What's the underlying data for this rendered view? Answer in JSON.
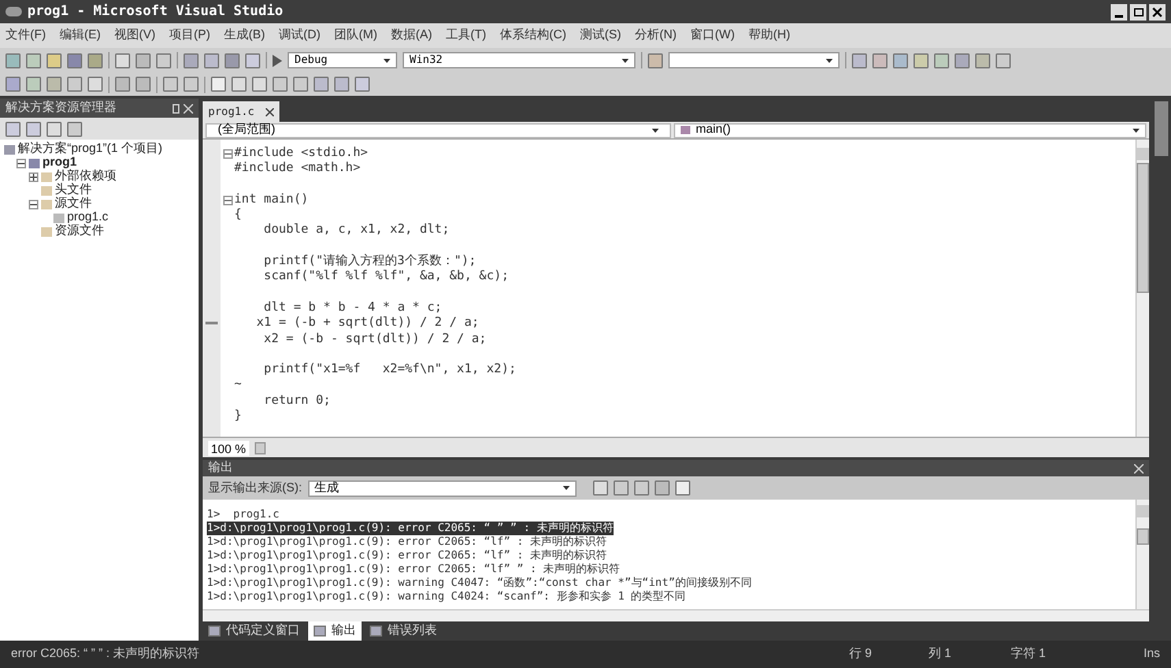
{
  "window": {
    "title": "prog1 - Microsoft Visual Studio"
  },
  "menu": [
    "文件(F)",
    "编辑(E)",
    "视图(V)",
    "项目(P)",
    "生成(B)",
    "调试(D)",
    "团队(M)",
    "数据(A)",
    "工具(T)",
    "体系结构(C)",
    "测试(S)",
    "分析(N)",
    "窗口(W)",
    "帮助(H)"
  ],
  "toolbar": {
    "configuration": "Debug",
    "platform": "Win32"
  },
  "solution_explorer": {
    "title": "解决方案资源管理器",
    "tree": [
      {
        "label": "解决方案“prog1”(1 个项目)",
        "kind": "solution",
        "children": [
          {
            "label": "prog1",
            "kind": "project",
            "expanded": true,
            "children": [
              {
                "label": "外部依赖项",
                "kind": "folder",
                "expanded": false
              },
              {
                "label": "头文件",
                "kind": "folder"
              },
              {
                "label": "源文件",
                "kind": "folder",
                "expanded": true,
                "children": [
                  {
                    "label": "prog1.c",
                    "kind": "file"
                  }
                ]
              },
              {
                "label": "资源文件",
                "kind": "folder"
              }
            ]
          }
        ]
      }
    ]
  },
  "editor": {
    "tabs": [
      {
        "label": "prog1.c",
        "selected": true
      }
    ],
    "scope": "(全局范围)",
    "member": "main()",
    "zoom": "100 %",
    "lines": [
      {
        "text": "#include <stdio.h>",
        "fold": true
      },
      {
        "text": "#include <math.h>",
        "fold": false
      },
      {
        "fold": false
      },
      {
        "text": "int main()",
        "fold": true
      },
      {
        "text": "{",
        "fold": false
      },
      {
        "text": "    double a, c, x1, x2, dlt;",
        "fold": false
      },
      {
        "fold": false
      },
      {
        "text": "    printf(\"请输入方程的3个系数：\");",
        "fold": false
      },
      {
        "text": "    scanf(\"%lf %lf %lf\", &a, &b, &c);",
        "fold": false
      },
      {
        "fold": false
      },
      {
        "text": "    dlt = b * b - 4 * a * c;",
        "fold": false
      },
      {
        "text": "   x1 = (-b + sqrt(dlt)) / 2 / a;",
        "fold": false
      },
      {
        "text": "    x2 = (-b - sqrt(dlt)) / 2 / a;",
        "fold": false
      },
      {
        "fold": false
      },
      {
        "text": "    printf(\"x1=%f   x2=%f\\n\", x1, x2);",
        "fold": false
      },
      {
        "text": "~",
        "fold": false
      },
      {
        "text": "    return 0;",
        "fold": false
      },
      {
        "text": "}",
        "fold": false
      }
    ]
  },
  "output": {
    "title": "输出",
    "source_label": "显示输出来源(S):",
    "source": "生成",
    "lines": [
      {
        "text": "1>  prog1.c",
        "selected": false
      },
      {
        "text": "1>d:\\prog1\\prog1\\prog1.c(9): error C2065: “ ” ” : 未声明的标识符",
        "selected": true
      },
      {
        "text": "1>d:\\prog1\\prog1\\prog1.c(9): error C2065: “lf” : 未声明的标识符",
        "selected": false
      },
      {
        "text": "1>d:\\prog1\\prog1\\prog1.c(9): error C2065: “lf” : 未声明的标识符",
        "selected": false
      },
      {
        "text": "1>d:\\prog1\\prog1\\prog1.c(9): error C2065: “lf” ” : 未声明的标识符",
        "selected": false
      },
      {
        "text": "1>d:\\prog1\\prog1\\prog1.c(9): warning C4047: “函数”:“const char *”与“int”的间接级别不同",
        "selected": false
      },
      {
        "text": "1>d:\\prog1\\prog1\\prog1.c(9): warning C4024: “scanf”: 形参和实参 1 的类型不同",
        "selected": false
      }
    ]
  },
  "bottom_tabs": [
    {
      "label": "代码定义窗口",
      "selected": false
    },
    {
      "label": "输出",
      "selected": true
    },
    {
      "label": "错误列表",
      "selected": false
    }
  ],
  "status_bar": {
    "message": "error C2065: “ ” ” : 未声明的标识符",
    "line": "行 9",
    "column": "列 1",
    "char": "字符 1",
    "mode": "Ins"
  }
}
